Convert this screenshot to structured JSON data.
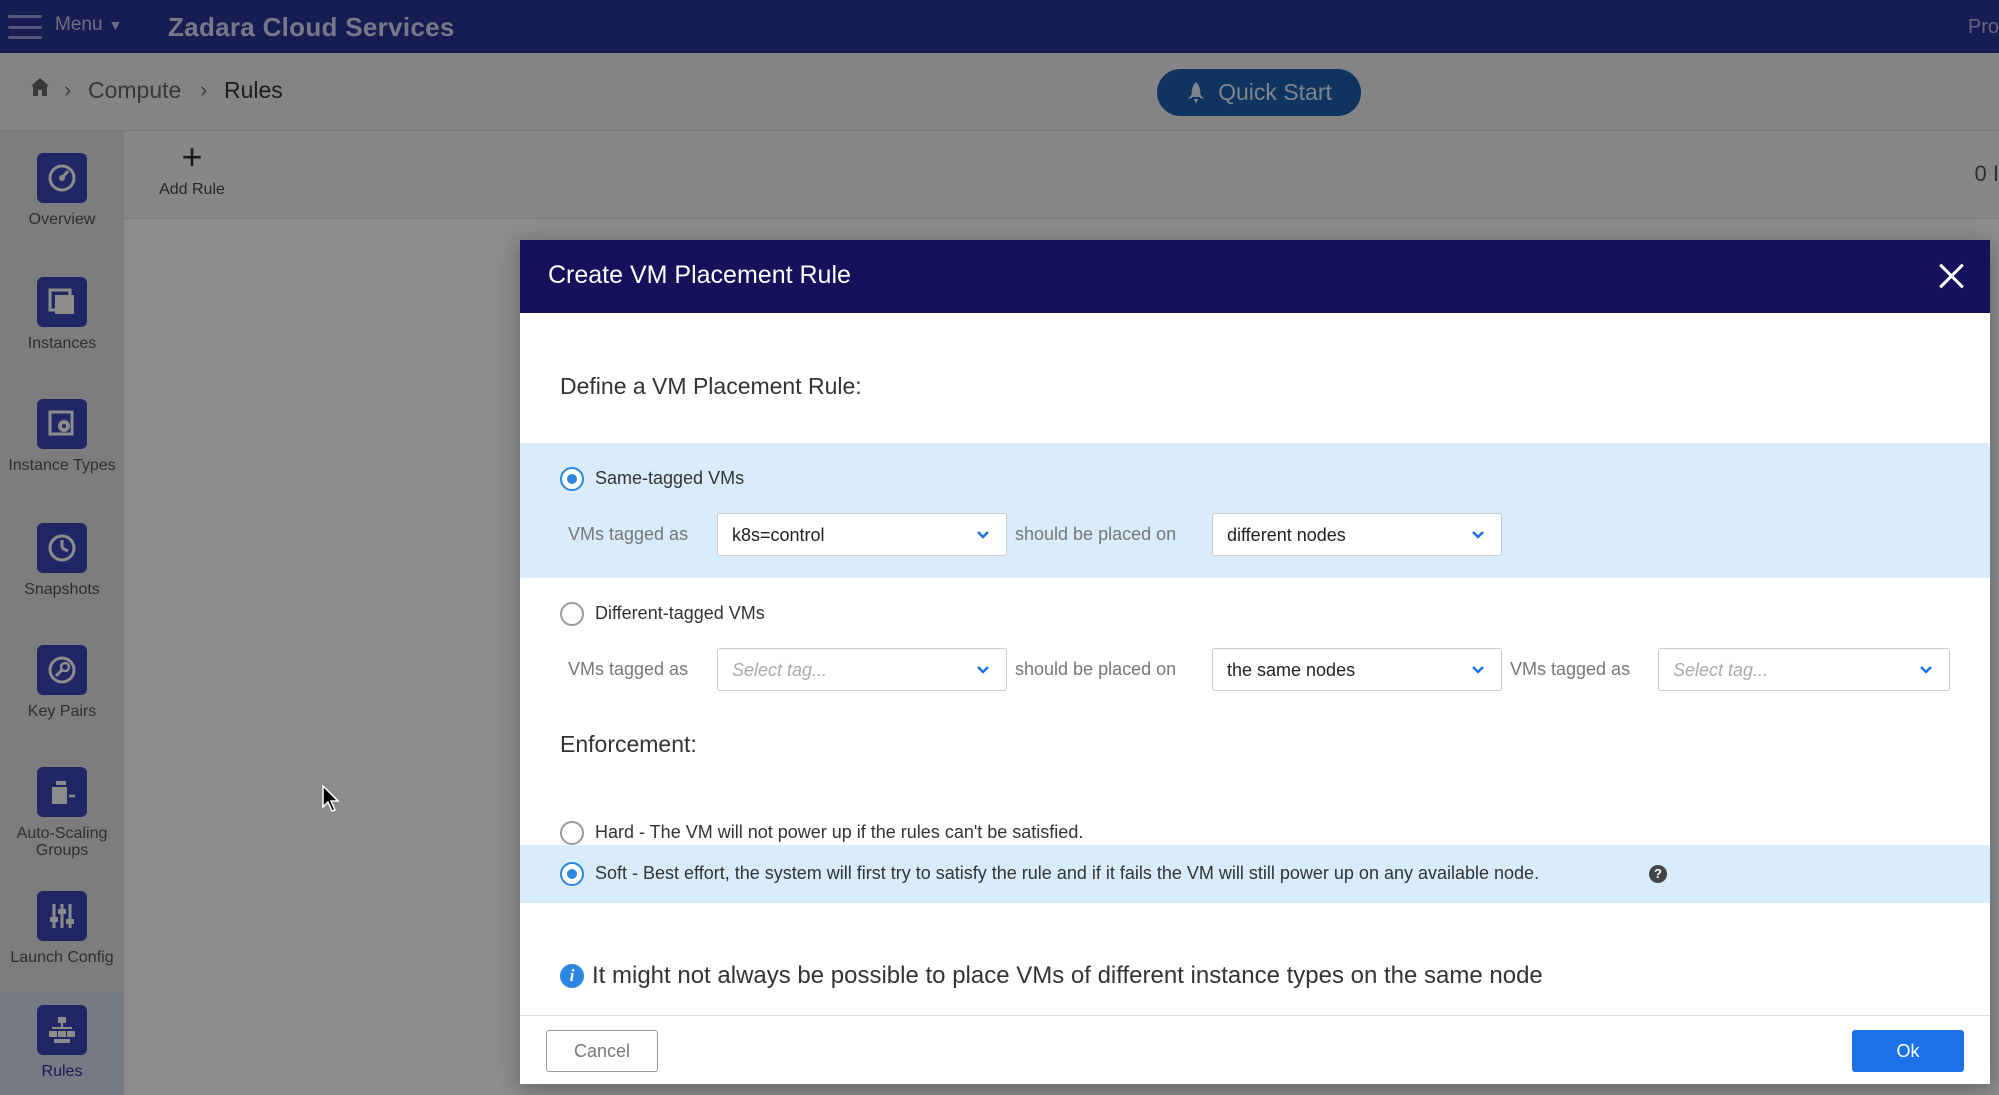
{
  "topbar": {
    "menu_label": "Menu",
    "app_title": "Zadara Cloud Services",
    "right_text": "Pro"
  },
  "breadcrumb": {
    "items": [
      "Compute",
      "Rules"
    ],
    "quick_start_label": "Quick Start"
  },
  "sidebar": {
    "items": [
      {
        "label": "Overview",
        "icon": "speedometer-icon"
      },
      {
        "label": "Instances",
        "icon": "instances-icon"
      },
      {
        "label": "Instance Types",
        "icon": "instance-types-icon"
      },
      {
        "label": "Snapshots",
        "icon": "snapshot-icon"
      },
      {
        "label": "Key Pairs",
        "icon": "key-icon"
      },
      {
        "label": "Auto-Scaling Groups",
        "icon": "auto-scaling-icon"
      },
      {
        "label": "Launch Config",
        "icon": "sliders-icon"
      },
      {
        "label": "Rules",
        "icon": "rules-icon",
        "active": true
      }
    ]
  },
  "toolbar": {
    "add_rule_label": "Add Rule",
    "right_text": "0 I"
  },
  "modal": {
    "title": "Create VM Placement Rule",
    "define_label": "Define a VM Placement Rule:",
    "same_tagged": {
      "label": "Same-tagged VMs",
      "selected": true,
      "tagged_as_label": "VMs tagged as",
      "tag_value": "k8s=control",
      "placed_on_label": "should be placed on",
      "placement_value": "different nodes"
    },
    "different_tagged": {
      "label": "Different-tagged VMs",
      "selected": false,
      "tagged_as_label": "VMs tagged as",
      "tag_placeholder": "Select tag...",
      "placed_on_label": "should be placed on",
      "placement_value": "the same nodes",
      "tagged_as_label_2": "VMs tagged as",
      "tag_placeholder_2": "Select tag..."
    },
    "enforcement_label": "Enforcement:",
    "hard_label": "Hard - The VM will not power up if the rules can't be satisfied.",
    "soft_label": "Soft - Best effort, the system will first try to satisfy the rule and if it fails the VM will still power up on any available node.",
    "enforcement_selected": "soft",
    "info_text": "It might not always be possible to place VMs of different instance types on the same node",
    "cancel_label": "Cancel",
    "ok_label": "Ok"
  },
  "colors": {
    "topbar": "#2a3498",
    "modal_header": "#15115a",
    "highlight": "#d9ecfb",
    "accent": "#1b72e8"
  }
}
